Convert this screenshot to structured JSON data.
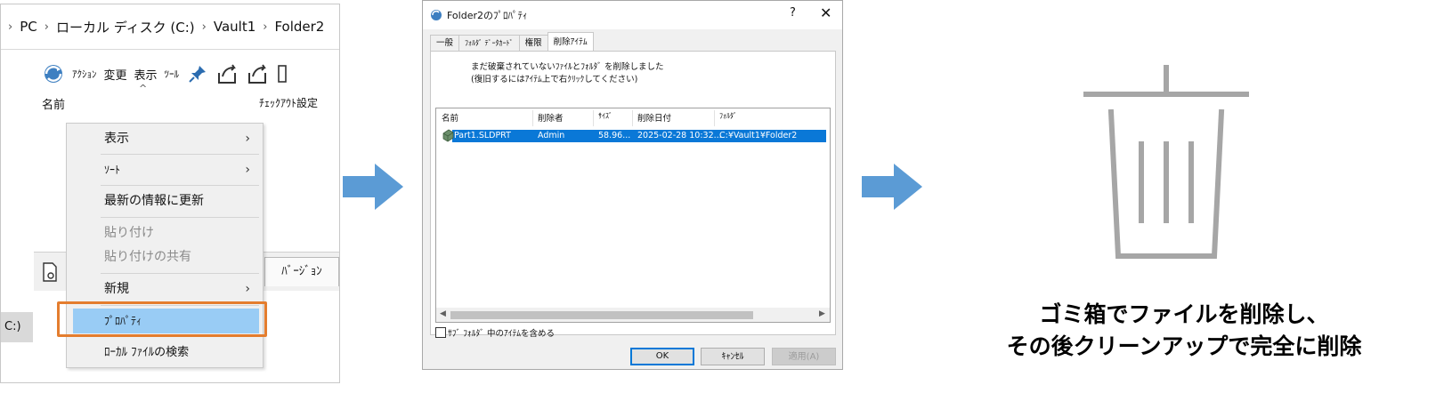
{
  "explorer": {
    "breadcrumbs": [
      "PC",
      "ローカル ディスク (C:)",
      "Vault1",
      "Folder2"
    ],
    "toolbar_labels": [
      "ｱｸｼｮﾝ",
      "変更",
      "表示",
      "ﾂｰﾙ"
    ],
    "column_name": "名前",
    "column_checkout": "ﾁｪｯｸｱｳﾄ設定",
    "version_tab": "ﾊﾞｰｼﾞｮﾝ",
    "left_label": "C:)"
  },
  "context_menu": {
    "items": [
      {
        "label": "表示",
        "has_submenu": true,
        "disabled": false
      },
      {
        "label": "ｿｰﾄ",
        "has_submenu": true,
        "disabled": false
      },
      {
        "label": "最新の情報に更新",
        "has_submenu": false,
        "disabled": false
      },
      {
        "label": "貼り付け",
        "has_submenu": false,
        "disabled": true
      },
      {
        "label": "貼り付けの共有",
        "has_submenu": false,
        "disabled": true
      },
      {
        "label": "新規",
        "has_submenu": true,
        "disabled": false
      },
      {
        "label": "ﾌﾟﾛﾊﾟﾃｨ",
        "has_submenu": false,
        "disabled": false,
        "selected": true
      },
      {
        "label": "ﾛｰｶﾙ ﾌｧｲﾙの検索",
        "has_submenu": false,
        "disabled": false
      }
    ],
    "highlight_color": "#e47d2e",
    "selected_color": "#99ccf5"
  },
  "dialog": {
    "title": "Folder2のﾌﾟﾛﾊﾟﾃｨ",
    "help": "?",
    "close": "✕",
    "tabs": [
      "一般",
      "ﾌｫﾙﾀﾞ ﾃﾞｰﾀｶｰﾄﾞ",
      "権限",
      "削除ｱｲﾃﾑ"
    ],
    "active_tab": "削除ｱｲﾃﾑ",
    "message_line1": "まだ破棄されていないﾌｧｲﾙとﾌｫﾙﾀﾞ を削除しました",
    "message_line2": "(復旧するにはｱｲﾃﾑ上で右ｸﾘｯｸしてください)",
    "columns": [
      "名前",
      "削除者",
      "ｻｲｽﾞ",
      "削除日付",
      "ﾌｫﾙﾀﾞ"
    ],
    "rows": [
      {
        "name": "Part1.SLDPRT",
        "deleted_by": "Admin",
        "size": "58.96...",
        "date": "2025-02-28 10:32...",
        "folder": "C:¥Vault1¥Folder2"
      }
    ],
    "include_subfolders": "ｻﾌﾞ ﾌｫﾙﾀﾞ 中のｱｲﾃﾑを含める",
    "ok": "OK",
    "cancel": "ｷｬﾝｾﾙ",
    "apply": "適用(A)",
    "selection_color": "#0a78d7"
  },
  "caption": {
    "line1": "ゴミ箱でファイルを削除し、",
    "line2": "その後クリーンアップで完全に削除"
  },
  "colors": {
    "arrow": "#5b9bd5",
    "trash": "#a6a6a6"
  }
}
